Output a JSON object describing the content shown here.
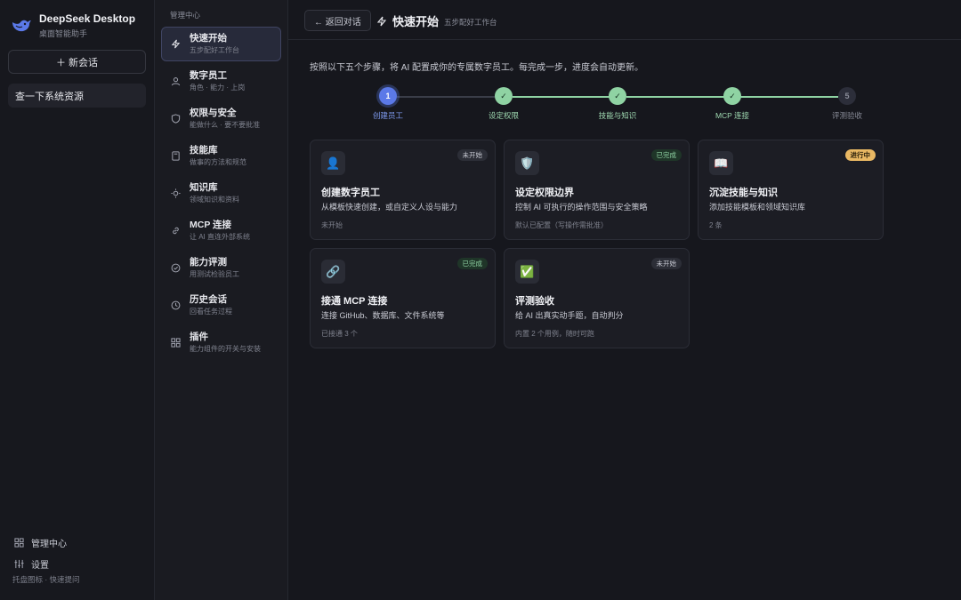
{
  "app": {
    "name": "DeepSeek Desktop",
    "subtitle": "桌面智能助手",
    "new_chat": "＋ 新会话",
    "conversations": [
      "查一下系统资源"
    ],
    "bottom": {
      "admin": "管理中心",
      "settings": "设置",
      "tray": "托盘图标 · 快速提问"
    }
  },
  "nav": {
    "title": "管理中心",
    "items": [
      {
        "label": "快速开始",
        "sub": "五步配好工作台",
        "icon": "lightning-icon",
        "active": true
      },
      {
        "label": "数字员工",
        "sub": "角色 · 能力 · 上岗",
        "icon": "person-icon"
      },
      {
        "label": "权限与安全",
        "sub": "能做什么 · 要不要批准",
        "icon": "shield-icon"
      },
      {
        "label": "技能库",
        "sub": "做事的方法和规范",
        "icon": "book-icon"
      },
      {
        "label": "知识库",
        "sub": "领域知识和资料",
        "icon": "bulb-icon"
      },
      {
        "label": "MCP 连接",
        "sub": "让 AI 直连外部系统",
        "icon": "link-icon"
      },
      {
        "label": "能力评测",
        "sub": "用测试检验员工",
        "icon": "check-circle-icon"
      },
      {
        "label": "历史会话",
        "sub": "回看任务过程",
        "icon": "clock-icon"
      },
      {
        "label": "插件",
        "sub": "能力组件的开关与安装",
        "icon": "grid-icon"
      }
    ]
  },
  "main": {
    "back": "← 返回对话",
    "title": "快速开始",
    "subtitle": "五步配好工作台",
    "intro": "按照以下五个步骤，将 AI 配置成你的专属数字员工。每完成一步，进度会自动更新。",
    "steps": [
      {
        "num": "1",
        "label": "创建员工",
        "state": "current"
      },
      {
        "num": "✓",
        "label": "设定权限",
        "state": "done"
      },
      {
        "num": "✓",
        "label": "技能与知识",
        "state": "done"
      },
      {
        "num": "✓",
        "label": "MCP 连接",
        "state": "done"
      },
      {
        "num": "5",
        "label": "评测验收",
        "state": "todo"
      }
    ],
    "cards": [
      {
        "icon": "👤",
        "title": "创建数字员工",
        "desc": "从模板快速创建，或自定义人设与能力",
        "meta": "未开始",
        "badge": "未开始",
        "status": "todo"
      },
      {
        "icon": "🛡️",
        "title": "设定权限边界",
        "desc": "控制 AI 可执行的操作范围与安全策略",
        "meta": "默认已配置（写操作需批准）",
        "badge": "已完成",
        "status": "done"
      },
      {
        "icon": "📖",
        "title": "沉淀技能与知识",
        "desc": "添加技能模板和领域知识库",
        "meta": "2 条",
        "badge": "进行中",
        "status": "doing"
      },
      {
        "icon": "🔗",
        "title": "接通 MCP 连接",
        "desc": "连接 GitHub、数据库、文件系统等",
        "meta": "已接通 3 个",
        "badge": "已完成",
        "status": "done"
      },
      {
        "icon": "✅",
        "title": "评测验收",
        "desc": "给 AI 出真实动手题，自动判分",
        "meta": "内置 2 个用例，随时可跑",
        "badge": "未开始",
        "status": "todo"
      }
    ]
  },
  "colors": {
    "accent": "#5b79e8",
    "done_green": "#8fd3a3",
    "doing_amber": "#e9b863"
  }
}
